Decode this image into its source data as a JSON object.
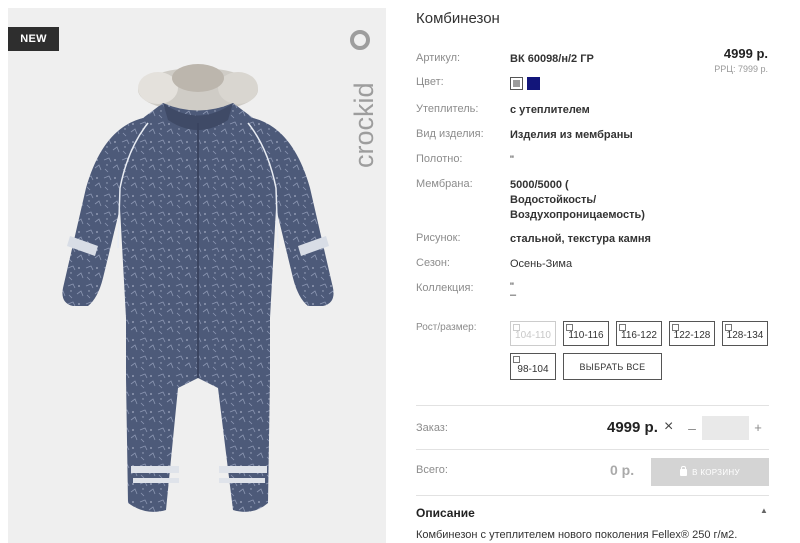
{
  "badge": "NEW",
  "brand": "crockid",
  "product": {
    "title": "Комбинезон",
    "price": "4999 р.",
    "rrp": "РРЦ: 7999 р."
  },
  "attributes": [
    {
      "label": "Артикул:",
      "value": "ВК 60098/н/2 ГР"
    },
    {
      "label": "Цвет:",
      "value": ""
    },
    {
      "label": "Утеплитель:",
      "value": "с утеплителем"
    },
    {
      "label": "Вид изделия:",
      "value": "Изделия из мембраны"
    },
    {
      "label": "Полотно:",
      "value": "\""
    },
    {
      "label": "Мембрана:",
      "lines": [
        "5000/5000 (",
        "Водостойкость/",
        "Воздухопроницаемость)"
      ]
    },
    {
      "label": "Рисунок:",
      "value": "стальной, текстура камня"
    },
    {
      "label": "Сезон:",
      "value": "Осень-Зима"
    },
    {
      "label": "Коллекция:",
      "lines": [
        "\"",
        "–"
      ]
    }
  ],
  "colors": {
    "grey": "#9b9b9b",
    "navy": "#12157a"
  },
  "sizes": {
    "label": "Рост/размер:",
    "options": [
      "104-110",
      "110-116",
      "116-122",
      "122-128",
      "128-134",
      "98-104"
    ],
    "disabled": [
      "104-110"
    ],
    "select_all": "ВЫБРАТЬ ВСЕ"
  },
  "order": {
    "label": "Заказ:",
    "price": "4999 р.",
    "minus": "–",
    "plus": "+",
    "quantity": ""
  },
  "total": {
    "label": "Всего:",
    "value": "0 р.",
    "cart_button": "В КОРЗИНУ"
  },
  "description": {
    "title": "Описание",
    "text": "Комбинезон с утеплителем нового поколения Fellex® 250 г/м2."
  }
}
